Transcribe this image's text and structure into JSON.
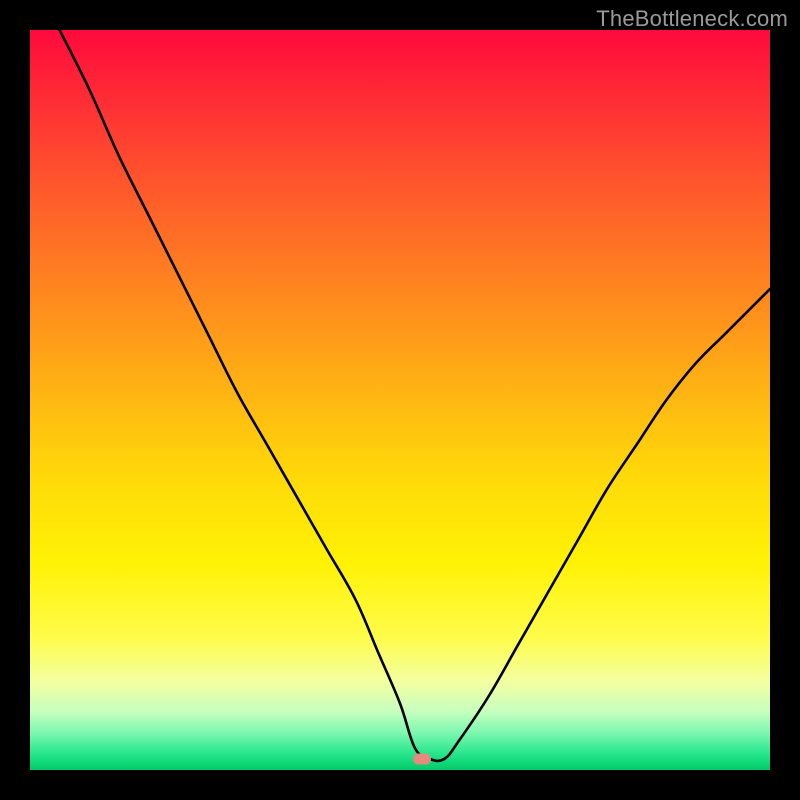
{
  "watermark": "TheBottleneck.com",
  "colors": {
    "frame_bg": "#000000",
    "curve_stroke": "#000000",
    "marker_fill": "#e68a7e",
    "gradient_top": "#ff0a3c",
    "gradient_bottom": "#07c86a"
  },
  "chart_data": {
    "type": "line",
    "title": "",
    "xlabel": "",
    "ylabel": "",
    "xlim": [
      0,
      100
    ],
    "ylim": [
      0,
      100
    ],
    "grid": false,
    "legend": false,
    "marker": {
      "x": 53,
      "y": 1.5
    },
    "series": [
      {
        "name": "bottleneck-curve",
        "x": [
          4,
          8,
          12,
          16,
          20,
          24,
          28,
          32,
          36,
          40,
          44,
          47,
          50,
          52,
          54,
          56,
          58,
          62,
          66,
          70,
          74,
          78,
          82,
          86,
          90,
          94,
          98,
          100
        ],
        "y": [
          100,
          92,
          83,
          75,
          67,
          59,
          51,
          44,
          37,
          30,
          23,
          16,
          9,
          3,
          1.5,
          1.5,
          4,
          10,
          17,
          24,
          31,
          38,
          44,
          50,
          55,
          59,
          63,
          65
        ]
      }
    ]
  }
}
